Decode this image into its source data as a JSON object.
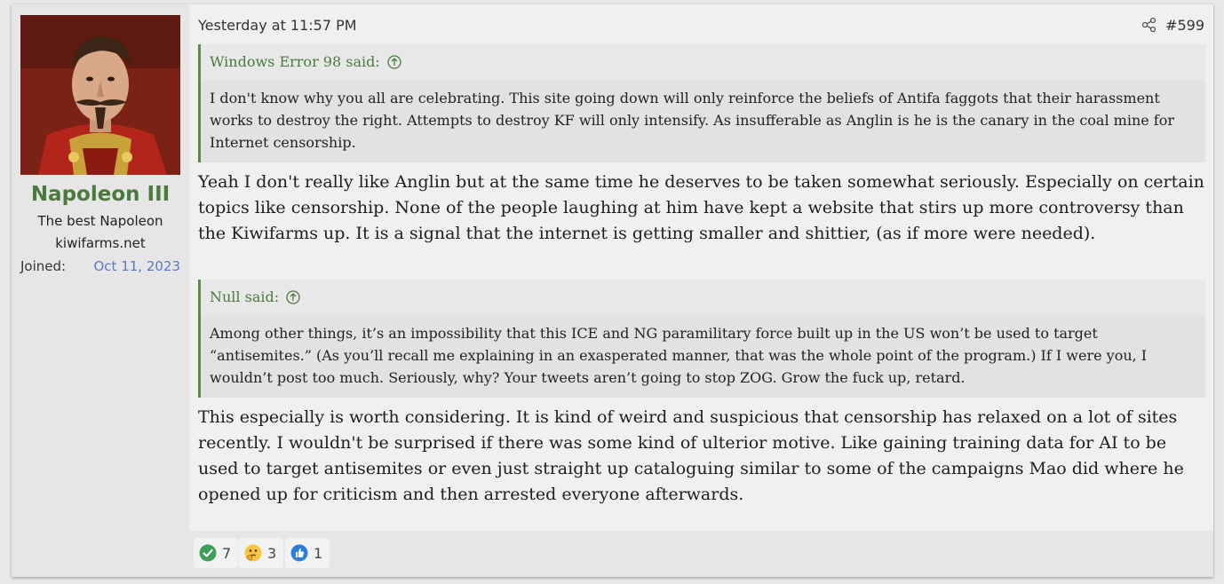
{
  "user": {
    "name": "Napoleon III",
    "title": "The best Napoleon",
    "site": "kiwifarms.net",
    "joined_label": "Joined:",
    "joined_value": "Oct 11, 2023"
  },
  "post": {
    "timestamp": "Yesterday at 11:57 PM",
    "number": "#599",
    "quotes": [
      {
        "author": "Windows Error 98 said:",
        "text": "I don't know why you all are celebrating. This site going down will only reinforce the beliefs of Antifa faggots that their harassment works to destroy the right. Attempts to destroy KF will only intensify. As insufferable as Anglin is he is the canary in the coal mine for Internet censorship."
      },
      {
        "author": "Null said:",
        "text": "Among other things, it’s an impossibility that this ICE and NG paramilitary force built up in the US won’t be used to target “antisemites.” (As you’ll recall me explaining in an exasperated manner, that was the whole point of the program.) If I were you, I wouldn’t post too much. Seriously, why? Your tweets aren’t going to stop ZOG. Grow the fuck up, retard."
      }
    ],
    "replies": [
      "Yeah I don't really like Anglin but at the same time he deserves to be taken somewhat seriously. Especially on certain topics like censorship. None of the people laughing at him have kept a website that stirs up more controversy than the Kiwifarms up. It is a signal that the internet is getting smaller and shittier, (as if more were needed).",
      "This especially is worth considering. It is kind of weird and suspicious that censorship has relaxed on a lot of sites recently. I wouldn't be surprised if there was some kind of ulterior motive. Like gaining training data for AI to be used to target antisemites or even just straight up cataloguing similar to some of the campaigns Mao did where he opened up for criticism and then arrested everyone afterwards."
    ]
  },
  "reactions": [
    {
      "icon": "check-icon",
      "count": "7"
    },
    {
      "icon": "thinking-icon",
      "count": "3"
    },
    {
      "icon": "thumbs-up-icon",
      "count": "1"
    }
  ],
  "colors": {
    "accent_green": "#4b7a3e",
    "link_blue": "#5f78c2"
  }
}
